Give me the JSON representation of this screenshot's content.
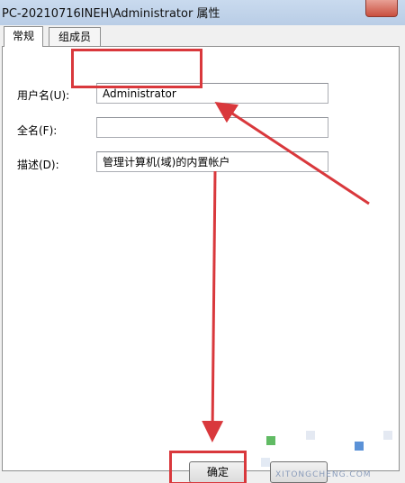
{
  "window": {
    "title": "PC-20210716INEH\\Administrator 属性"
  },
  "tabs": [
    {
      "label": "常规",
      "active": true
    },
    {
      "label": "组成员",
      "active": false
    }
  ],
  "form": {
    "username_label": "用户名(U):",
    "username_value": "Administrator",
    "fullname_label": "全名(F):",
    "fullname_value": "",
    "description_label": "描述(D):",
    "description_value": "管理计算机(域)的内置帐户"
  },
  "buttons": {
    "ok_label": "确定"
  },
  "watermark": {
    "text": "XITONGCHENG.COM"
  },
  "colors": {
    "annotation_red": "#d9383c",
    "panel_bg": "#ffffff",
    "window_bg": "#f0f0f0"
  }
}
